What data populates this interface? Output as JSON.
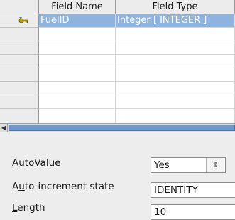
{
  "grid": {
    "columns": [
      {
        "label": "Field Name"
      },
      {
        "label": "Field Type"
      }
    ],
    "rows": [
      {
        "name": "FuelID",
        "type": "Integer [ INTEGER ]",
        "primary_key_icon": "key-icon"
      }
    ]
  },
  "properties": {
    "autovalue": {
      "label_prefix": "",
      "label_mnemonic": "A",
      "label_rest": "utoValue",
      "value": "Yes",
      "control_icon": "spin-updown-icon"
    },
    "autoincrement": {
      "label_prefix": "A",
      "label_mnemonic": "u",
      "label_rest": "to-increment state",
      "value": "IDENTITY"
    },
    "length": {
      "label_prefix": "",
      "label_mnemonic": "L",
      "label_rest": "ength",
      "value": "10"
    }
  }
}
